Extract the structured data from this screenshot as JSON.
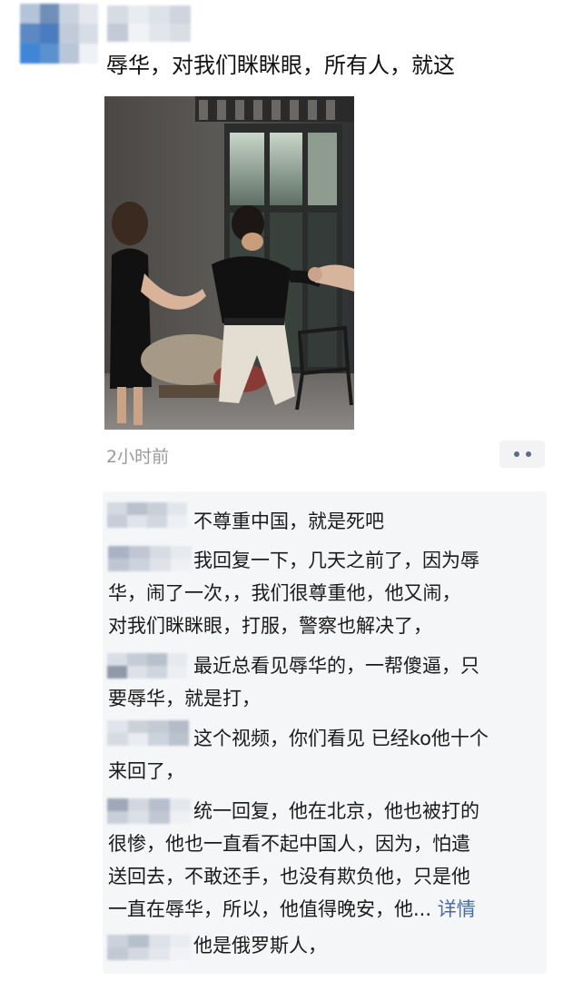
{
  "post": {
    "text": "辱华，对我们眯眯眼，所有人，就这",
    "timestamp": "2小时前",
    "more_icon": "more-dots-icon"
  },
  "comments": [
    {
      "lines": [
        "不尊重中国，就是死吧"
      ]
    },
    {
      "lines": [
        "我回复一下，几天之前了，因为辱",
        "华，闹了一次，，我们很尊重他，他又闹，",
        "对我们眯眯眼，打服，警察也解决了，"
      ]
    },
    {
      "lines": [
        "最近总看见辱华的，一帮傻逼，只",
        "要辱华，就是打，"
      ]
    },
    {
      "lines": [
        "这个视频，你们看见  已经ko他十个",
        "来回了，"
      ]
    },
    {
      "lines": [
        "统一回复，他在北京，他也被打的",
        "很惨，他也一直看不起中国人，因为，怕遣",
        "送回去，不敢还手，也没有欺负他，只是他",
        "一直在辱华，所以，他值得晚安，他..."
      ],
      "detail_label": "详情"
    },
    {
      "lines": [
        "他是俄罗斯人，"
      ]
    }
  ],
  "colors": {
    "link": "#4a6aa5",
    "timestamp": "#9a9a9a",
    "comment_bg": "#f5f6f8"
  }
}
